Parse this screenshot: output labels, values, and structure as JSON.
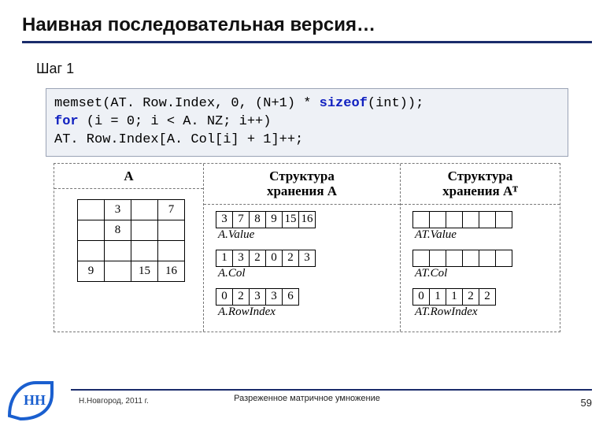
{
  "title": "Наивная последовательная версия…",
  "step": "Шаг 1",
  "code": {
    "l1a": "memset(AT. Row.Index, 0, (N+1) * ",
    "l1kw": "sizeof",
    "l1b": "(int));",
    "l2kw": "for",
    "l2": " (i = 0; i < A. NZ; i++)",
    "l3": "  AT. Row.Index[A. Col[i] + 1]++;"
  },
  "headers": {
    "A": "A",
    "mid_l1": "Структура",
    "mid_l2": "хранения A",
    "right_l1": "Структура",
    "right_l2": "хранения Aᵀ"
  },
  "matrixA": [
    [
      "",
      "3",
      "",
      "7"
    ],
    [
      "",
      "8",
      "",
      ""
    ],
    [
      "",
      "",
      "",
      ""
    ],
    [
      "9",
      "",
      "15",
      "16"
    ]
  ],
  "structA": {
    "value": [
      "3",
      "7",
      "8",
      "9",
      "15",
      "16"
    ],
    "value_label": "A.Value",
    "col": [
      "1",
      "3",
      "2",
      "0",
      "2",
      "3"
    ],
    "col_label": "A.Col",
    "rowindex": [
      "0",
      "2",
      "3",
      "3",
      "6"
    ],
    "rowindex_label": "A.RowIndex"
  },
  "structAT": {
    "value": [
      "",
      "",
      "",
      "",
      "",
      ""
    ],
    "value_label": "AT.Value",
    "col": [
      "",
      "",
      "",
      "",
      "",
      ""
    ],
    "col_label": "AT.Col",
    "rowindex": [
      "0",
      "1",
      "1",
      "2",
      "2"
    ],
    "rowindex_label": "AT.RowIndex"
  },
  "footer": {
    "left": "Н.Новгород, 2011 г.",
    "center": "Разреженное матричное умножение",
    "page": "59"
  }
}
